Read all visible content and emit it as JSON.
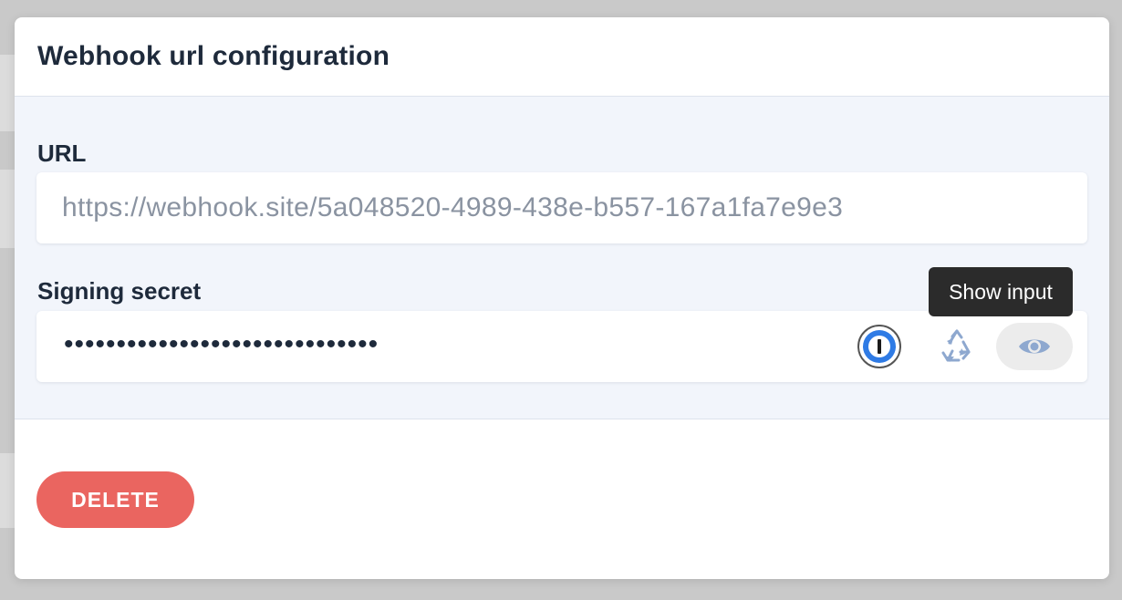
{
  "modal": {
    "title": "Webhook url configuration",
    "url_label": "URL",
    "url_value": "https://webhook.site/5a048520-4989-438e-b557-167a1fa7e9e3",
    "secret_label": "Signing secret",
    "secret_value": "••••••••••••••••••••••••••••••",
    "tooltip": "Show input",
    "delete_label": "DELETE"
  },
  "icons": {
    "password_manager": "1password-icon",
    "regenerate": "recycle-icon",
    "show": "eye-icon"
  },
  "colors": {
    "delete_button": "#ea6560",
    "body_background": "#f2f5fb",
    "title_text": "#1e2a3b",
    "url_text": "#8a93a1",
    "icon_accent": "#8ea8cf",
    "tooltip_bg": "#2b2b2b"
  }
}
